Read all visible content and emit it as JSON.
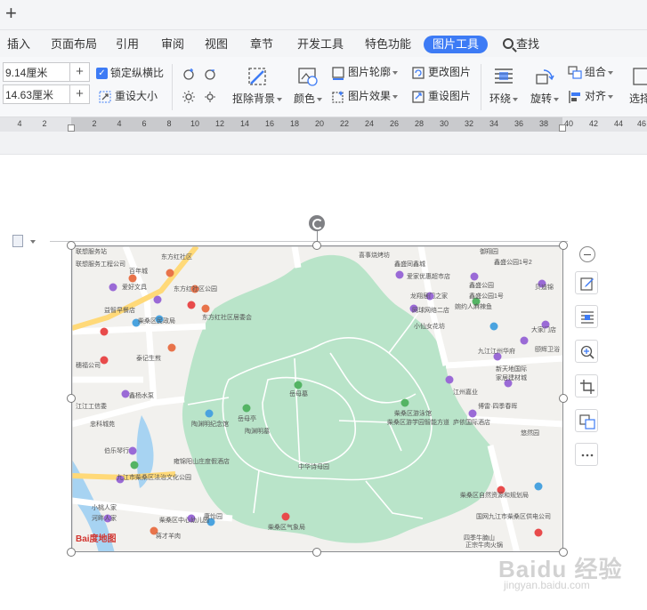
{
  "topbar": {
    "new_tab_symbol": "+"
  },
  "tabs": [
    {
      "label": "插入",
      "active": false
    },
    {
      "label": "页面布局",
      "active": false
    },
    {
      "label": "引用",
      "active": false
    },
    {
      "label": "审阅",
      "active": false
    },
    {
      "label": "视图",
      "active": false
    },
    {
      "label": "章节",
      "active": false
    },
    {
      "label": "开发工具",
      "active": false
    },
    {
      "label": "特色功能",
      "active": false
    },
    {
      "label": "图片工具",
      "active": true
    }
  ],
  "search_label": "查找",
  "ribbon": {
    "width_value": "9.14厘米",
    "height_value": "14.63厘米",
    "lock_ratio_label": "锁定纵横比",
    "reset_size_label": "重设大小",
    "remove_bg_label": "抠除背景",
    "color_label": "颜色",
    "outline_label": "图片轮廓",
    "effect_label": "图片效果",
    "change_pic_label": "更改图片",
    "reset_pic_label": "重设图片",
    "wrap_label": "环绕",
    "rotate_label": "旋转",
    "group_label": "组合",
    "align_label": "对齐",
    "select_label": "选择",
    "step_symbol": "+"
  },
  "ruler": {
    "ticks": [
      "4",
      "2",
      "2",
      "4",
      "6",
      "8",
      "10",
      "12",
      "14",
      "16",
      "18",
      "20",
      "22",
      "24",
      "26",
      "28",
      "30",
      "32",
      "34",
      "36",
      "38",
      "40",
      "42",
      "44",
      "46"
    ]
  },
  "map": {
    "labels": {
      "l1": "联想服务站",
      "l2": "东方红社区",
      "l3": "喜事烧烤坊",
      "l4": "鑫盛同鑫城",
      "l5": "御翔园",
      "l6": "鑫盛公园1号2",
      "l7": "爱家优惠超市店",
      "l8": "鑫盛公园",
      "l9": "联想服务工程公司",
      "l10": "爱好文具",
      "l11": "东方红社区公园",
      "l12": "龙翔居门之家",
      "l13": "益智早餐店",
      "l14": "东方红社区居委会",
      "l15": "柴桑区民政局",
      "l16": "网球网络二店",
      "l17": "小仙女花坊",
      "l18": "婉约人麻辣鱼",
      "l19": "九江江州华府",
      "l20": "新天地国际",
      "l21": "家居建材城",
      "l22": "江州嘉业",
      "l23": "岳母墓",
      "l24": "岳母亭",
      "l25": "陶渊明纪念馆",
      "l26": "陶渊明墓",
      "l27": "柴桑区游泳馆",
      "l28": "柴桑区游学园智能方道",
      "l29": "庐依国际酒店",
      "l30": "悠然园",
      "l31": "博雷·四季春晖",
      "l32": "中华诗母园",
      "l33": "柴桑区气象局",
      "l34": "柴桑区自然资源和规划局",
      "l35": "国网九江市柴桑区供电公司",
      "l36": "四季牛腩山",
      "l37": "正宗牛肉火锅",
      "l38": "九江市柴桑区法治文化公园",
      "l39": "柴桑区中心幼儿园",
      "l40": "康怡园",
      "l41": "蒋才羊肉",
      "l42": "小桃人家",
      "l43": "河畔人家",
      "l44": "忠科城苑",
      "l45": "伯乐琴行",
      "l46": "鑫杨水泵",
      "l47": "江江工信委",
      "l48": "泰记生煎",
      "l49": "雍锦阳山庄度假酒店",
      "l50": "百年城",
      "l51": "鑫盛公园1号",
      "l52": "贝迪锦",
      "l53": "大家门店",
      "l54": "颐辉卫浴",
      "l55": "穗福公司"
    },
    "logo_text": "Bai度地图"
  },
  "watermark": {
    "main": "Baidu 经验",
    "sub": "jingyan.baidu.com"
  },
  "colors": {
    "accent": "#3d7bf5",
    "park": "#b9e4c9",
    "road": "#ffffff",
    "land": "#f2f1ee"
  }
}
